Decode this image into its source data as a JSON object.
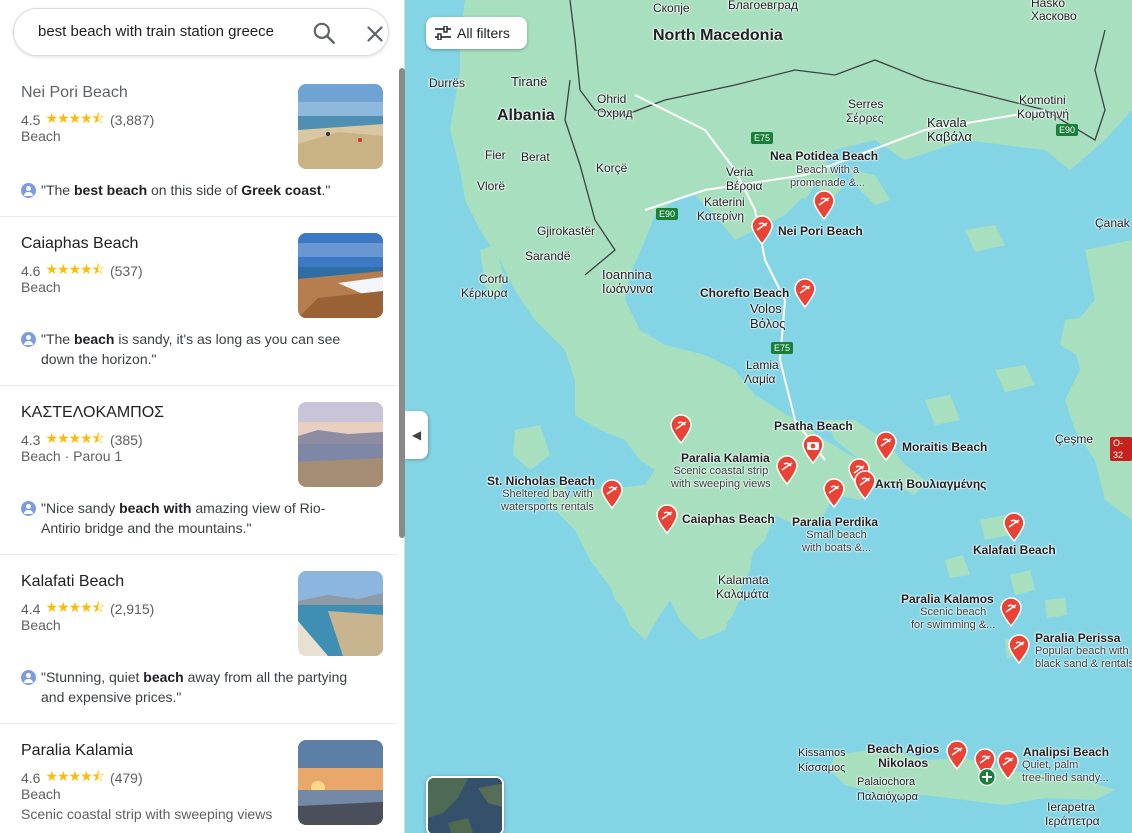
{
  "search": {
    "value": "best beach with train station greece"
  },
  "results": [
    {
      "name": "Nei Pori Beach",
      "rating": "4.5",
      "stars": "★★★★⯪",
      "count": "(3,887)",
      "category": "Beach",
      "desc": "",
      "review_pre": "\"The ",
      "review_b1": "best beach",
      "review_mid": " on this side of ",
      "review_b2": "Greek coast",
      "review_post": ".\""
    },
    {
      "name": "Caiaphas Beach",
      "rating": "4.6",
      "stars": "★★★★⯪",
      "count": "(537)",
      "category": "Beach",
      "desc": "",
      "review_pre": "\"The ",
      "review_b1": "beach",
      "review_mid": " is sandy, it's as long as you can see down the horizon.\"",
      "review_b2": "",
      "review_post": ""
    },
    {
      "name": "ΚΑΣΤΕΛΟΚΑΜΠΟΣ",
      "rating": "4.3",
      "stars": "★★★★⯪",
      "count": "(385)",
      "category": "Beach · Parou 1",
      "desc": "",
      "review_pre": "\"Nice sandy ",
      "review_b1": "beach with",
      "review_mid": " amazing view of Rio-Antirio bridge and the mountains.\"",
      "review_b2": "",
      "review_post": ""
    },
    {
      "name": "Kalafati Beach",
      "rating": "4.4",
      "stars": "★★★★⯪",
      "count": "(2,915)",
      "category": "Beach",
      "desc": "",
      "review_pre": "\"Stunning, quiet ",
      "review_b1": "beach",
      "review_mid": " away from all the partying and expensive prices.\"",
      "review_b2": "",
      "review_post": ""
    },
    {
      "name": "Paralia Kalamia",
      "rating": "4.6",
      "stars": "★★★★⯪",
      "count": "(479)",
      "category": "Beach",
      "desc": "Scenic coastal strip with sweeping views",
      "review_pre": "",
      "review_b1": "",
      "review_mid": "",
      "review_b2": "",
      "review_post": ""
    }
  ],
  "map": {
    "filters_label": "All filters",
    "countries": [
      "North Macedonia",
      "Albania"
    ],
    "cities": {
      "skopje": "Скопје",
      "blagoevgrad": "Благоевград",
      "haskovo": "Hasko",
      "haskovo2": "Хасково",
      "durres": "Durrës",
      "tirane": "Tiranë",
      "ohrid": "Ohrid",
      "ohrid2": "Охрид",
      "serres": "Serres",
      "serres2": "Σέρρες",
      "komotini": "Komotini",
      "komotini2": "Κομοτηνή",
      "kavala": "Kavala",
      "kavala2": "Καβάλα",
      "fier": "Fier",
      "berat": "Berat",
      "korce": "Korçë",
      "vlore": "Vlorë",
      "veria": "Veria",
      "veria2": "Βέροια",
      "katerini": "Katerini",
      "katerini2": "Κατερίνη",
      "gjirokaster": "Gjirokastër",
      "sarande": "Sarandë",
      "corfu": "Corfu",
      "corfu2": "Κέρκυρα",
      "ioannina": "Ioannina",
      "ioannina2": "Ιωάννινα",
      "volos": "Volos",
      "volos2": "Βόλος",
      "lamia": "Lamia",
      "lamia2": "Λαμία",
      "canak": "Çanak",
      "cesme": "Çeşme",
      "kalamata": "Kalamata",
      "kalamata2": "Καλαμάτα",
      "kissamos": "Kissamos",
      "kissamos2": "Κίσσαμος",
      "palaiochora": "Palaiochora",
      "palaiochora2": "Παλαιόχωρα",
      "ierapetra": "Ierapetra",
      "ierapetra2": "Ιεράπετρα"
    },
    "roads": {
      "e75a": "E75",
      "e75b": "E75",
      "e90a": "E90",
      "e90b": "E90",
      "o32": "O-32"
    },
    "pois": {
      "nea_potidea": "Nea Potidea Beach",
      "nea_potidea_sub": "Beach with a\npromenade &...",
      "nei_pori": "Nei Pori Beach",
      "chorefto": "Chorefto Beach",
      "psatha": "Psatha Beach",
      "moraitis": "Moraitis Beach",
      "aktivouliag": "Ακτή Βουλιαγμένης",
      "paralia_kalamia": "Paralia Kalamia",
      "paralia_kalamia_sub": "Scenic coastal strip\nwith sweeping views",
      "st_nicholas": "St. Nicholas Beach",
      "st_nicholas_sub": "Sheltered bay with\nwatersports rentals",
      "caiaphas": "Caiaphas Beach",
      "perdika": "Paralia Perdika",
      "perdika_sub": "Small beach\nwith boats &...",
      "kalafati": "Kalafati Beach",
      "kalamos": "Paralia Kalamos",
      "kalamos_sub": "Scenic beach\nfor swimming &...",
      "perissa": "Paralia Perissa",
      "perissa_sub": "Popular beach with\nblack sand & rentals",
      "agios_nikolaos": "Beach Agios\nNikolaos",
      "analipsi": "Analipsi Beach",
      "analipsi_sub": "Quiet, palm\ntree-lined sandy..."
    },
    "colors": {
      "water": "#83d5e6",
      "land": "#a8e0bf",
      "pin": "#ea4335"
    }
  }
}
